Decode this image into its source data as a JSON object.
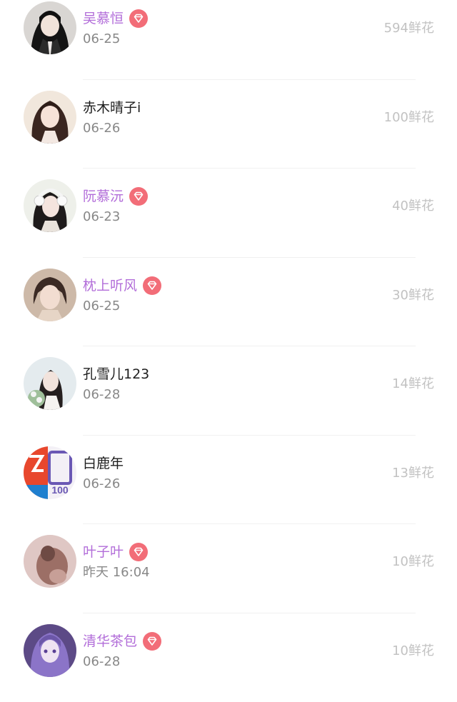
{
  "colors": {
    "vip_name": "#b26dd9",
    "normal_name": "#1e1e1e",
    "date": "#888888",
    "flowers": "#c2c2c2",
    "vip_badge": "#f26d78",
    "divider": "#f0f0f0"
  },
  "rows": [
    {
      "name": "吴慕恒",
      "vip": true,
      "date": "06-25",
      "flowers": "594鲜花",
      "avatar": "girl-dark-uniform"
    },
    {
      "name": "赤木晴子i",
      "vip": false,
      "date": "06-26",
      "flowers": "100鲜花",
      "avatar": "girl-long-hair"
    },
    {
      "name": "阮慕沅",
      "vip": true,
      "date": "06-23",
      "flowers": "40鲜花",
      "avatar": "girl-headphones"
    },
    {
      "name": "枕上听风",
      "vip": true,
      "date": "06-25",
      "flowers": "30鲜花",
      "avatar": "boy-anime"
    },
    {
      "name": "孔雪儿123",
      "vip": false,
      "date": "06-28",
      "flowers": "14鲜花",
      "avatar": "girl-flowers"
    },
    {
      "name": "白鹿年",
      "vip": false,
      "date": "06-26",
      "flowers": "13鲜花",
      "avatar": "logo-badge"
    },
    {
      "name": "叶子叶",
      "vip": true,
      "date": "昨天 16:04",
      "flowers": "10鲜花",
      "avatar": "pink-blur"
    },
    {
      "name": "清华茶包",
      "vip": true,
      "date": "06-28",
      "flowers": "10鲜花",
      "avatar": "purple-anime"
    }
  ]
}
